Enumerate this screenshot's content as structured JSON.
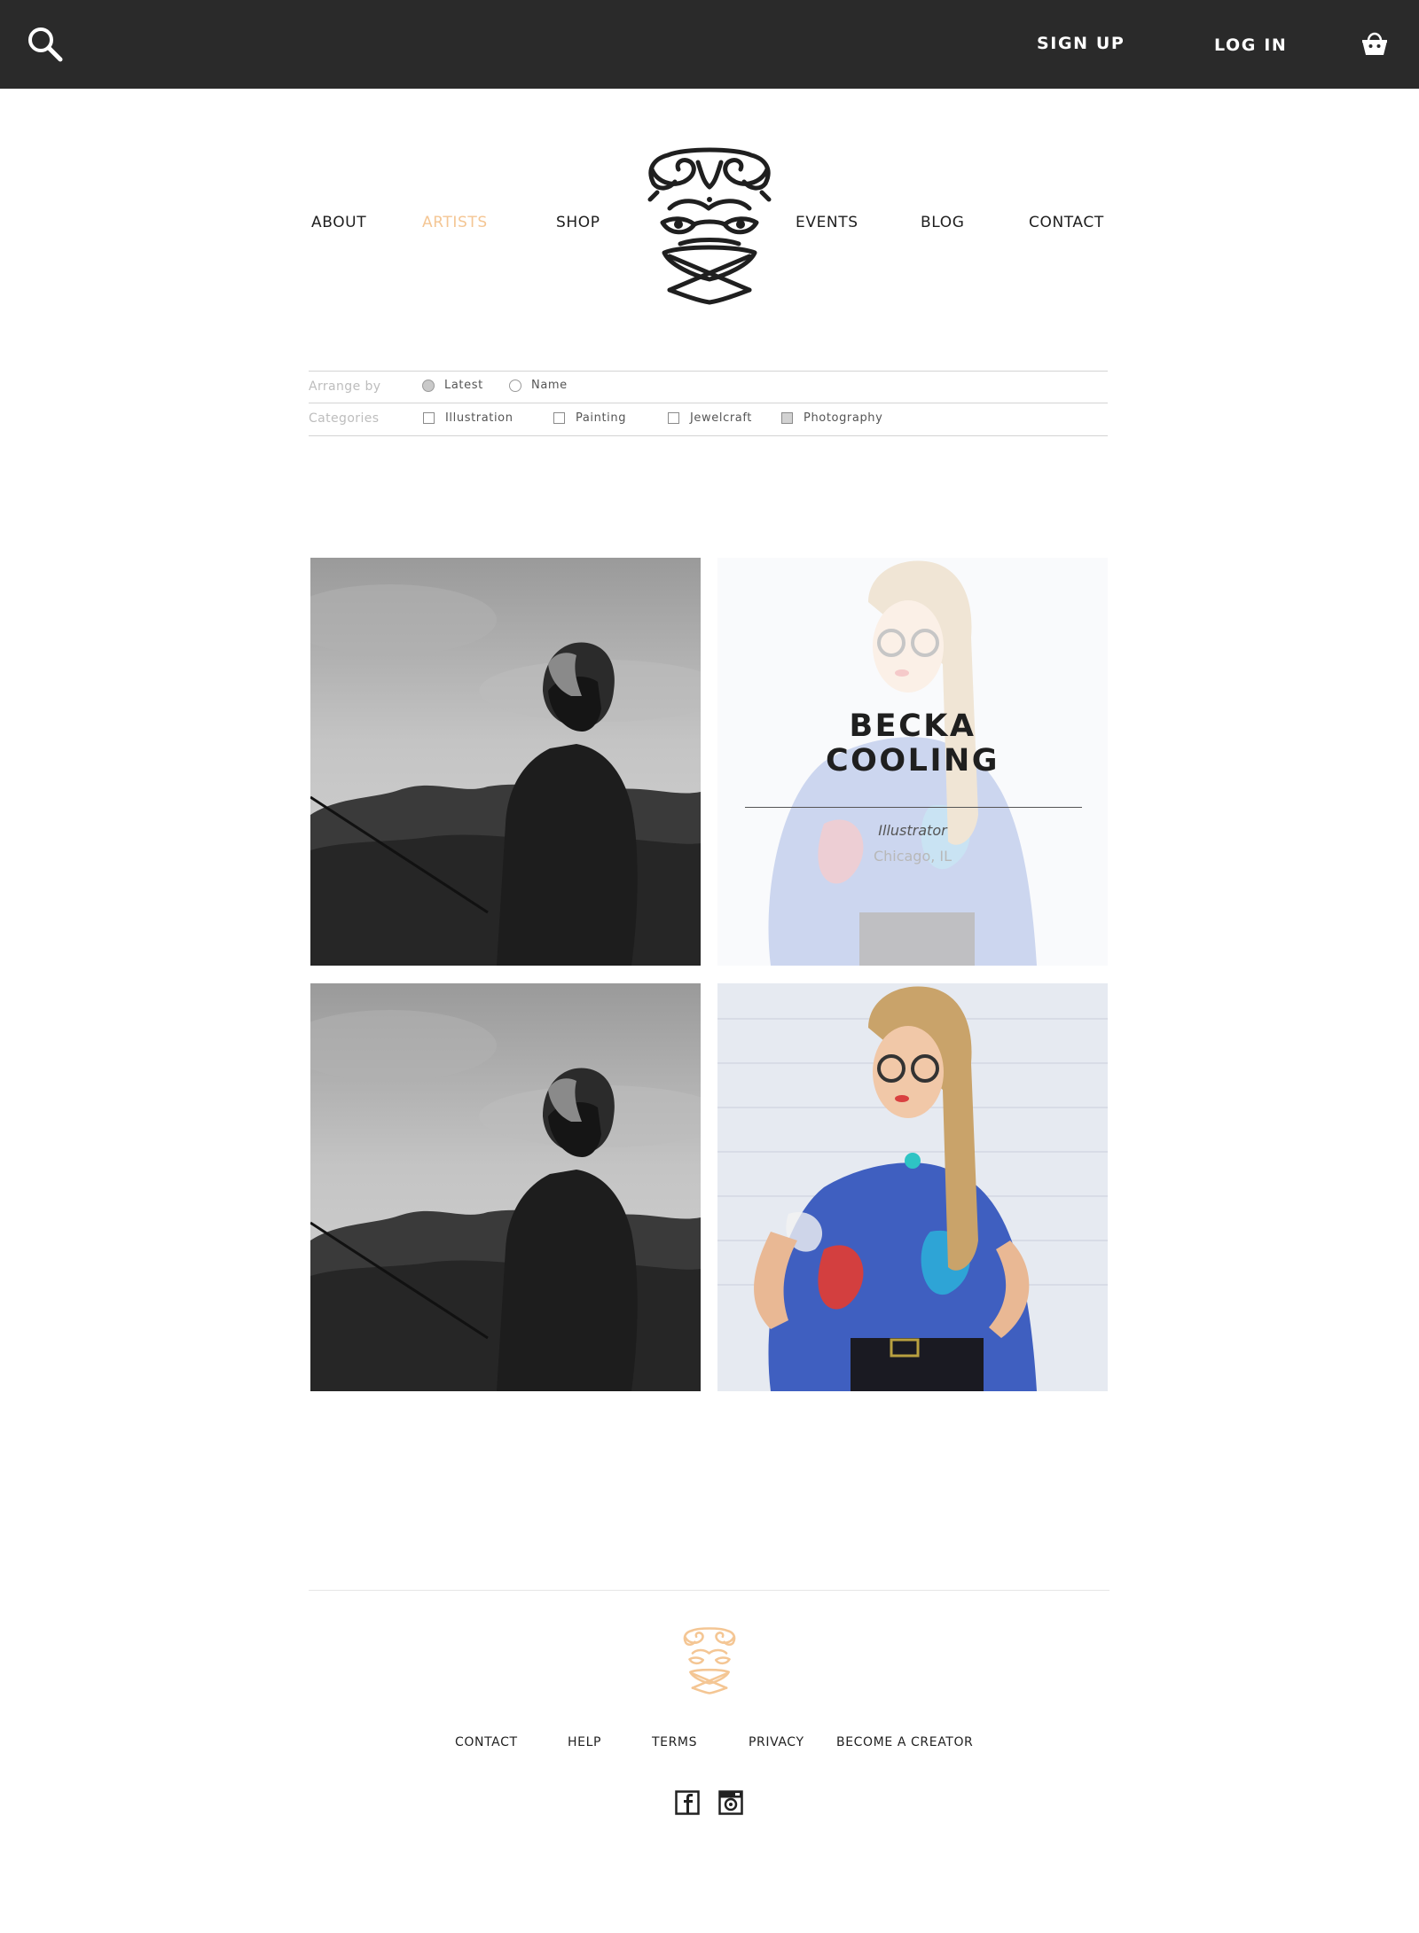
{
  "topbar": {
    "search_icon": "search-icon",
    "signup_label": "SIGN UP",
    "login_label": "LOG IN",
    "cart_icon": "basket-icon",
    "background": "#2a2a2a"
  },
  "nav": {
    "items": [
      {
        "label": "ABOUT"
      },
      {
        "label": "ARTISTS",
        "active": true
      },
      {
        "label": "SHOP"
      },
      {
        "label": "EVENTS"
      },
      {
        "label": "BLOG"
      },
      {
        "label": "CONTACT"
      }
    ],
    "active_color": "#f4c694"
  },
  "filters": {
    "arrange_label": "Arrange by",
    "arrange_options": [
      {
        "label": "Latest",
        "selected": true
      },
      {
        "label": "Name",
        "selected": false
      }
    ],
    "categories_label": "Categories",
    "categories": [
      {
        "label": "Illustration",
        "checked": false
      },
      {
        "label": "Painting",
        "checked": false
      },
      {
        "label": "Jewelcraft",
        "checked": false
      },
      {
        "label": "Photography",
        "checked": true
      }
    ]
  },
  "artists": [
    {
      "photo": "bearded-man-bw-photo"
    },
    {
      "photo": "woman-glasses-photo",
      "name": "BECKA COOLING",
      "role": "Illustrator",
      "location": "Chicago, IL"
    },
    {
      "photo": "bearded-man-bw-photo"
    },
    {
      "photo": "woman-glasses-photo"
    }
  ],
  "footer": {
    "links": [
      "CONTACT",
      "HELP",
      "TERMS",
      "PRIVACY",
      "BECOME A CREATOR"
    ],
    "social": [
      "facebook-icon",
      "instagram-icon"
    ],
    "logo_color": "#f4c694"
  }
}
